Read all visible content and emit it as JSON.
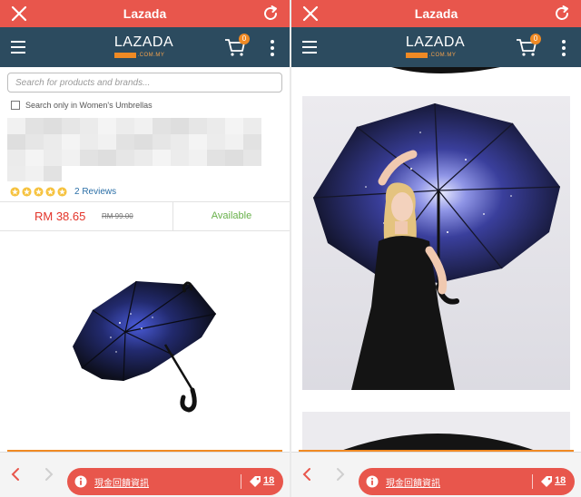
{
  "app": {
    "title": "Lazada",
    "logo_text": "LAZADA",
    "logo_domain": ".COM.MY",
    "cart_count": "0"
  },
  "colors": {
    "titlebar": "#e8564c",
    "navbar": "#2c4b5f",
    "accent_orange": "#f08a24",
    "price_red": "#e3342a",
    "available_green": "#68b04a",
    "link_blue": "#2b6fa7"
  },
  "icons": {
    "close": "close-icon",
    "reload": "reload-icon",
    "menu": "hamburger-menu-icon",
    "cart": "shopping-cart-icon",
    "more": "more-vertical-icon",
    "back": "chevron-left-icon",
    "forward": "chevron-right-icon",
    "info": "info-icon",
    "tag": "tag-icon"
  },
  "product": {
    "search_placeholder": "Search for products and brands...",
    "search_scope_label": "Search only in Women's Umbrellas",
    "rating_stars": 5,
    "reviews_label": "2 Reviews",
    "price": "RM 38.65",
    "original_price": "RM 99.00",
    "availability": "Available"
  },
  "bottom_bar": {
    "cashback_label": "現金回饋資訊",
    "cashback_count": "18"
  }
}
